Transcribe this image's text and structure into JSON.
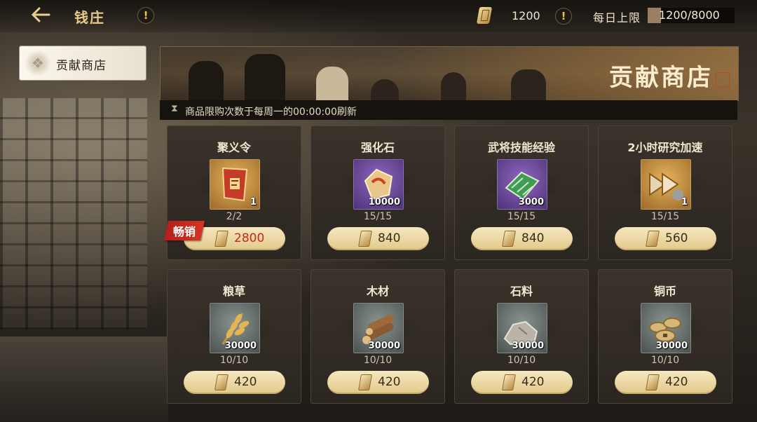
{
  "header": {
    "title": "钱庄",
    "currency_value": "1200",
    "daily_limit_label": "每日上限",
    "daily_limit_value": "1200/8000",
    "daily_limit_fraction": 0.15
  },
  "sidebar": {
    "items": [
      {
        "label": "贡献商店",
        "selected": true
      }
    ]
  },
  "banner": {
    "title": "贡献商店",
    "notice": "商品限购次数于每周一的00:00:00刷新"
  },
  "items": [
    {
      "name": "聚义令",
      "icon": "token-scroll-icon",
      "quality": "gold",
      "qty": "1",
      "limit": "2/2",
      "price": "2800",
      "tag": "畅销"
    },
    {
      "name": "强化石",
      "icon": "enhance-stone-icon",
      "quality": "purple",
      "qty": "10000",
      "limit": "15/15",
      "price": "840",
      "tag": ""
    },
    {
      "name": "武将技能经验",
      "icon": "skill-book-icon",
      "quality": "purple",
      "qty": "3000",
      "limit": "15/15",
      "price": "840",
      "tag": ""
    },
    {
      "name": "2小时研究加速",
      "icon": "speedup-arrows-icon",
      "quality": "gold",
      "qty": "1",
      "limit": "15/15",
      "price": "560",
      "tag": ""
    },
    {
      "name": "粮草",
      "icon": "wheat-icon",
      "quality": "gray",
      "qty": "30000",
      "limit": "10/10",
      "price": "420",
      "tag": ""
    },
    {
      "name": "木材",
      "icon": "wood-logs-icon",
      "quality": "gray",
      "qty": "30000",
      "limit": "10/10",
      "price": "420",
      "tag": ""
    },
    {
      "name": "石料",
      "icon": "stone-icon",
      "quality": "gray",
      "qty": "30000",
      "limit": "10/10",
      "price": "420",
      "tag": ""
    },
    {
      "name": "铜币",
      "icon": "copper-coins-icon",
      "quality": "gray",
      "qty": "30000",
      "limit": "10/10",
      "price": "420",
      "tag": ""
    }
  ],
  "colors": {
    "accent_gold": "#e8c98a",
    "price_hot": "#c8281c",
    "tag_red": "#b51f1a"
  }
}
